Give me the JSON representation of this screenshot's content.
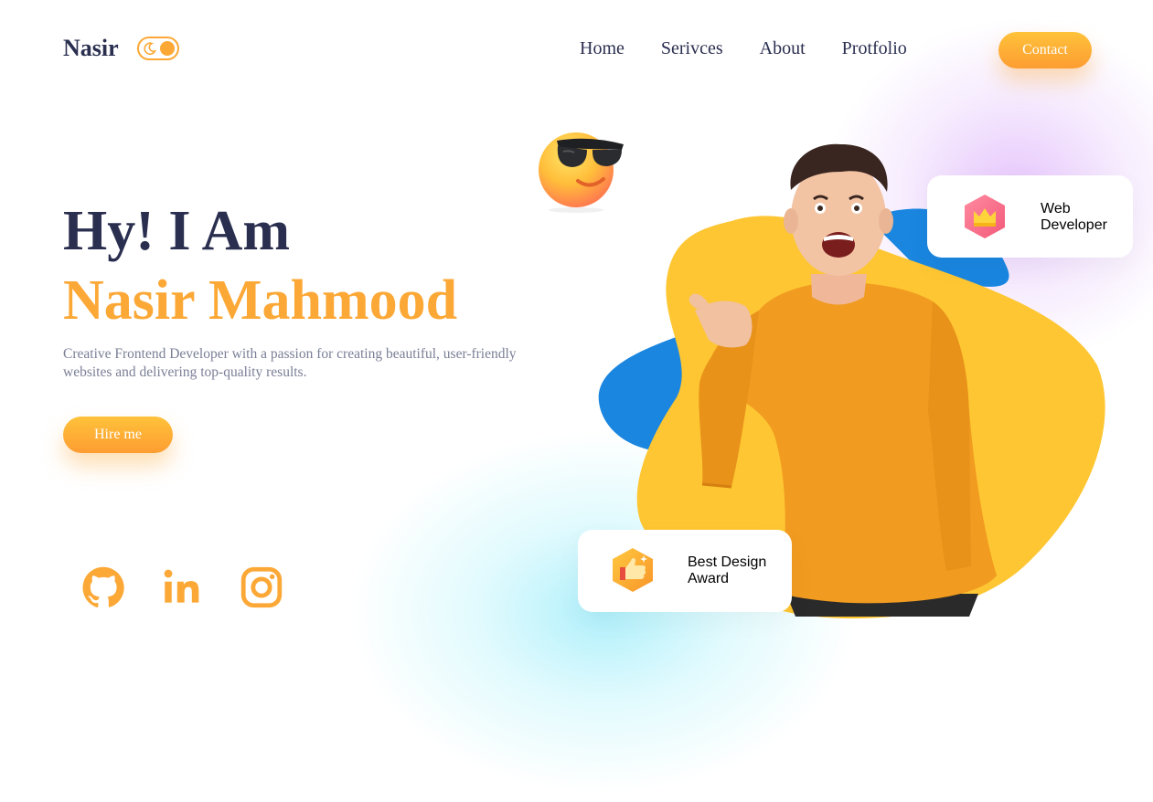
{
  "header": {
    "logo": "Nasir",
    "nav": [
      "Home",
      "Serivces",
      "About",
      "Protfolio"
    ],
    "contact_label": "Contact",
    "theme_toggle_icon": "moon-icon"
  },
  "hero": {
    "greeting": "Hy! I Am",
    "name": "Nasir Mahmood",
    "description": "Creative Frontend Developer with a passion for creating beautiful, user-friendly websites and delivering top-quality results.",
    "hire_label": "Hire me"
  },
  "social": [
    {
      "icon": "github-icon"
    },
    {
      "icon": "linkedin-icon"
    },
    {
      "icon": "instagram-icon"
    }
  ],
  "cards": {
    "web": {
      "line1": "Web",
      "line2": "Developer",
      "icon": "crown-icon"
    },
    "award": {
      "line1": "Best Design",
      "line2": "Award",
      "icon": "thumbs-up-icon"
    }
  },
  "colors": {
    "accent": "#fca836",
    "dark": "#2a2f4f",
    "blob_yellow": "#fec632",
    "blob_blue": "#1a86e0",
    "sweater": "#f19b20"
  }
}
